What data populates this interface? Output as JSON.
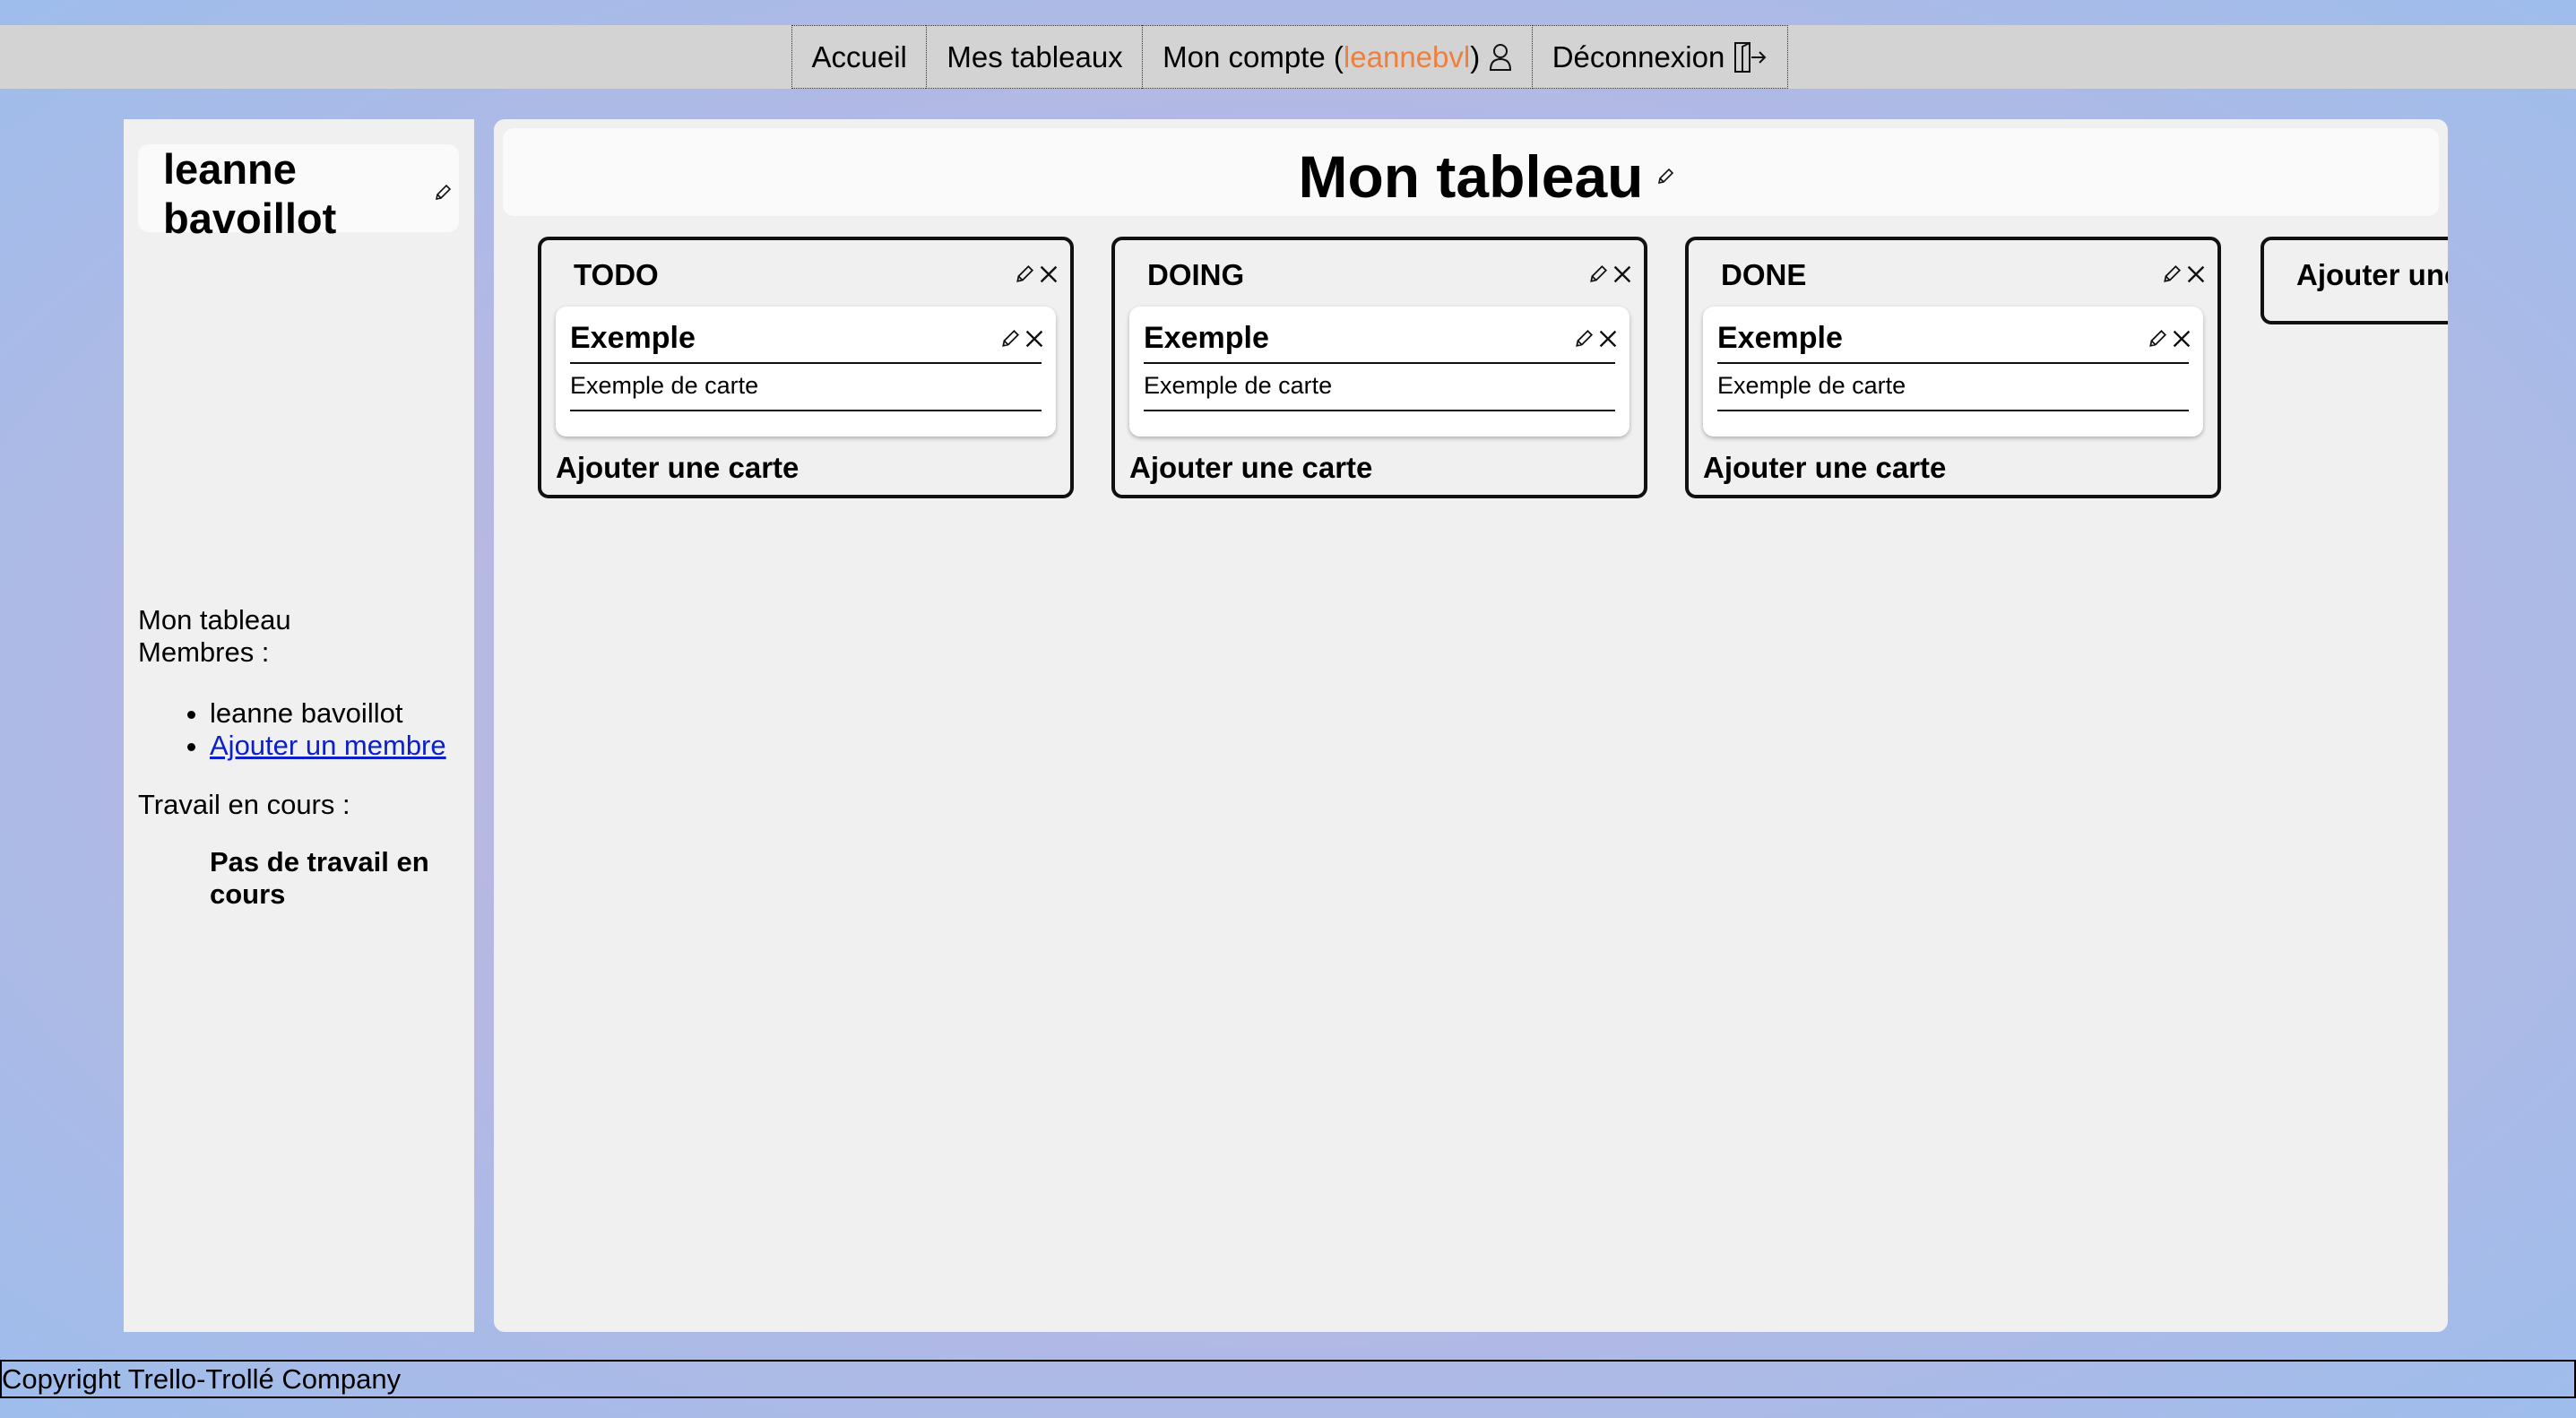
{
  "nav": {
    "home": "Accueil",
    "boards": "Mes tableaux",
    "account_prefix": "Mon compte (",
    "account_user": "leannebvl",
    "account_suffix": ")",
    "logout": "Déconnexion"
  },
  "sidebar": {
    "user_first": "leanne",
    "user_last": "bavoillot",
    "board_name": "Mon tableau",
    "members_label": "Membres :",
    "members": [
      "leanne bavoillot"
    ],
    "add_member": "Ajouter un membre",
    "work_label": "Travail en cours :",
    "no_work": "Pas de travail en cours"
  },
  "board": {
    "title": "Mon tableau",
    "lists": [
      {
        "title": "TODO",
        "card_title": "Exemple",
        "card_desc": "Exemple de carte",
        "add_card": "Ajouter une carte"
      },
      {
        "title": "DOING",
        "card_title": "Exemple",
        "card_desc": "Exemple de carte",
        "add_card": "Ajouter une carte"
      },
      {
        "title": "DONE",
        "card_title": "Exemple",
        "card_desc": "Exemple de carte",
        "add_card": "Ajouter une carte"
      }
    ],
    "add_list": "Ajouter une colonne"
  },
  "footer": {
    "copyright": "Copyright Trello-Trollé Company"
  },
  "colors": {
    "username_accent": "#f07f3c",
    "link": "#0b20c9"
  }
}
